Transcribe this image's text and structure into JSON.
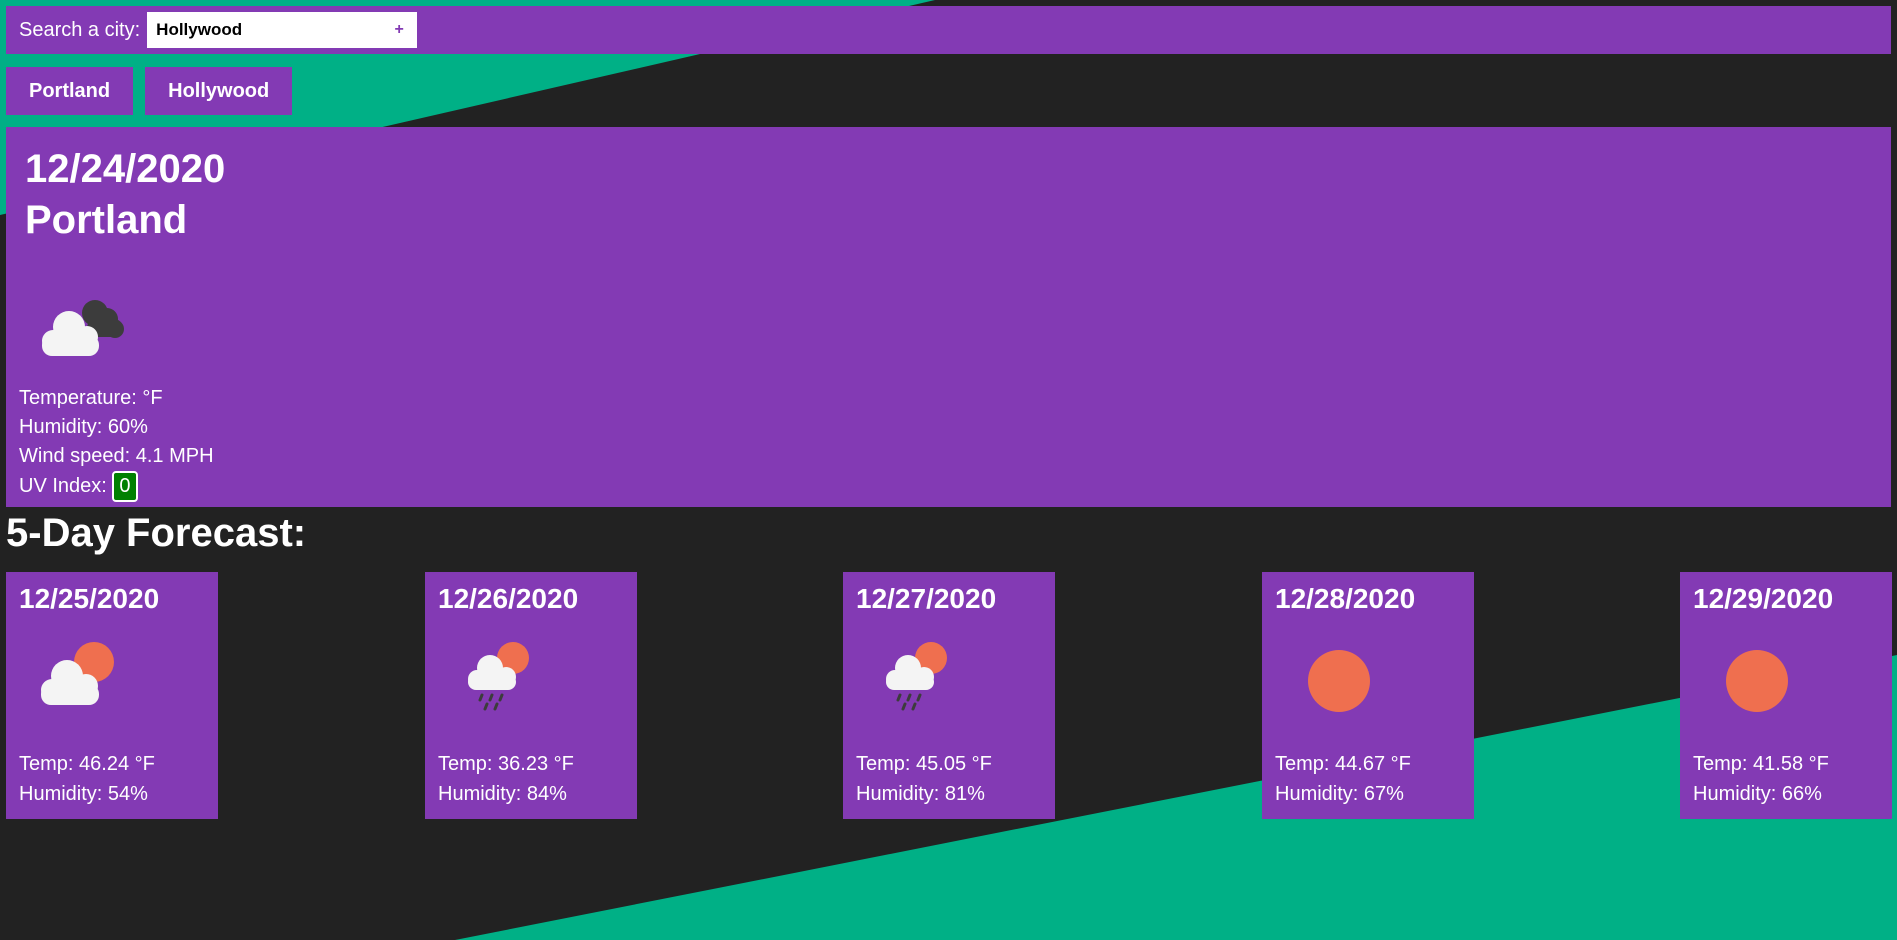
{
  "search": {
    "label": "Search a city:",
    "value": "Hollywood",
    "button": "+"
  },
  "history": [
    "Portland",
    "Hollywood"
  ],
  "current": {
    "date": "12/24/2020",
    "city": "Portland",
    "icon": "cloud-dark-cloud-icon",
    "temperature": "Temperature: °F",
    "humidity": "Humidity: 60%",
    "wind": "Wind speed: 4.1 MPH",
    "uv_label": "UV Index:",
    "uv_value": "0",
    "uv_color": "#008000"
  },
  "forecast_title": "5-Day Forecast:",
  "forecast": [
    {
      "date": "12/25/2020",
      "icon": "partly-cloudy-icon",
      "temp": "Temp: 46.24 °F",
      "humidity": "Humidity: 54%"
    },
    {
      "date": "12/26/2020",
      "icon": "rain-sun-icon",
      "temp": "Temp: 36.23 °F",
      "humidity": "Humidity: 84%"
    },
    {
      "date": "12/27/2020",
      "icon": "rain-sun-icon",
      "temp": "Temp: 45.05 °F",
      "humidity": "Humidity: 81%"
    },
    {
      "date": "12/28/2020",
      "icon": "sun-icon",
      "temp": "Temp: 44.67 °F",
      "humidity": "Humidity: 67%"
    },
    {
      "date": "12/29/2020",
      "icon": "sun-icon",
      "temp": "Temp: 41.58 °F",
      "humidity": "Humidity: 66%"
    }
  ],
  "colors": {
    "panel": "#833ab4",
    "background": "#222222",
    "accent": "#00b086",
    "sun": "#ef6f4f"
  }
}
